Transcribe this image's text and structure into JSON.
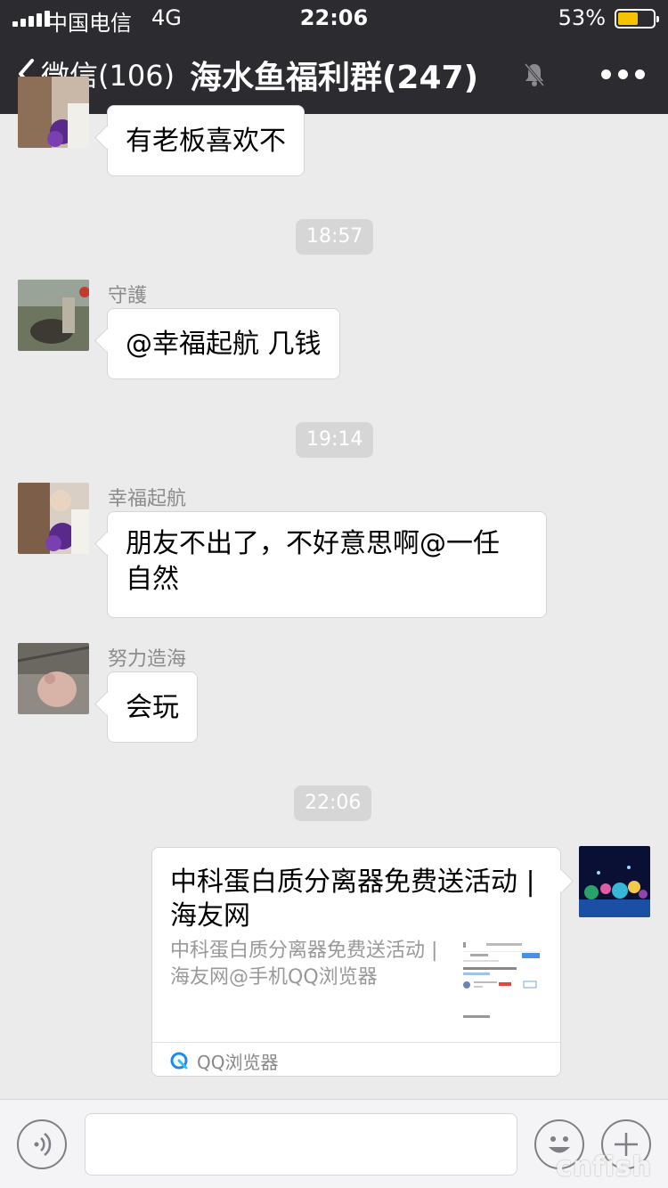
{
  "status_bar": {
    "carrier": "中国电信",
    "network": "4G",
    "time": "22:06",
    "battery": "53%",
    "battery_level": 0.53
  },
  "nav": {
    "back_label": "微信(106)",
    "title": "海水鱼福利群(247)"
  },
  "messages": [
    {
      "text": "有老板喜欢不"
    },
    {
      "timestamp": "18:57"
    },
    {
      "sender": "守護",
      "text": "@幸福起航 几钱"
    },
    {
      "timestamp": "19:14"
    },
    {
      "sender": "幸福起航",
      "text_line1": "朋友不出了，不好意思啊@一任",
      "text_line2": "自然"
    },
    {
      "sender": "努力造海",
      "text": "会玩"
    },
    {
      "timestamp": "22:06"
    },
    {
      "card_title": "中科蛋白质分离器免费送活动 | 海友网",
      "card_desc": "中科蛋白质分离器免费送活动 | 海友网@手机QQ浏览器",
      "card_source": "QQ浏览器"
    }
  ],
  "input_bar": {
    "placeholder": ""
  },
  "watermark": "cnfish",
  "colors": {
    "nav_bg": "#2b2b30",
    "chat_bg": "#ebebeb",
    "battery": "#f5c400",
    "qq_blue": "#1e8ce6"
  },
  "icons": {
    "back": "chevron-left-icon",
    "mute": "bell-off-icon",
    "more": "more-dots-icon",
    "voice": "voice-icon",
    "emoji": "emoji-icon",
    "plus": "plus-icon"
  }
}
